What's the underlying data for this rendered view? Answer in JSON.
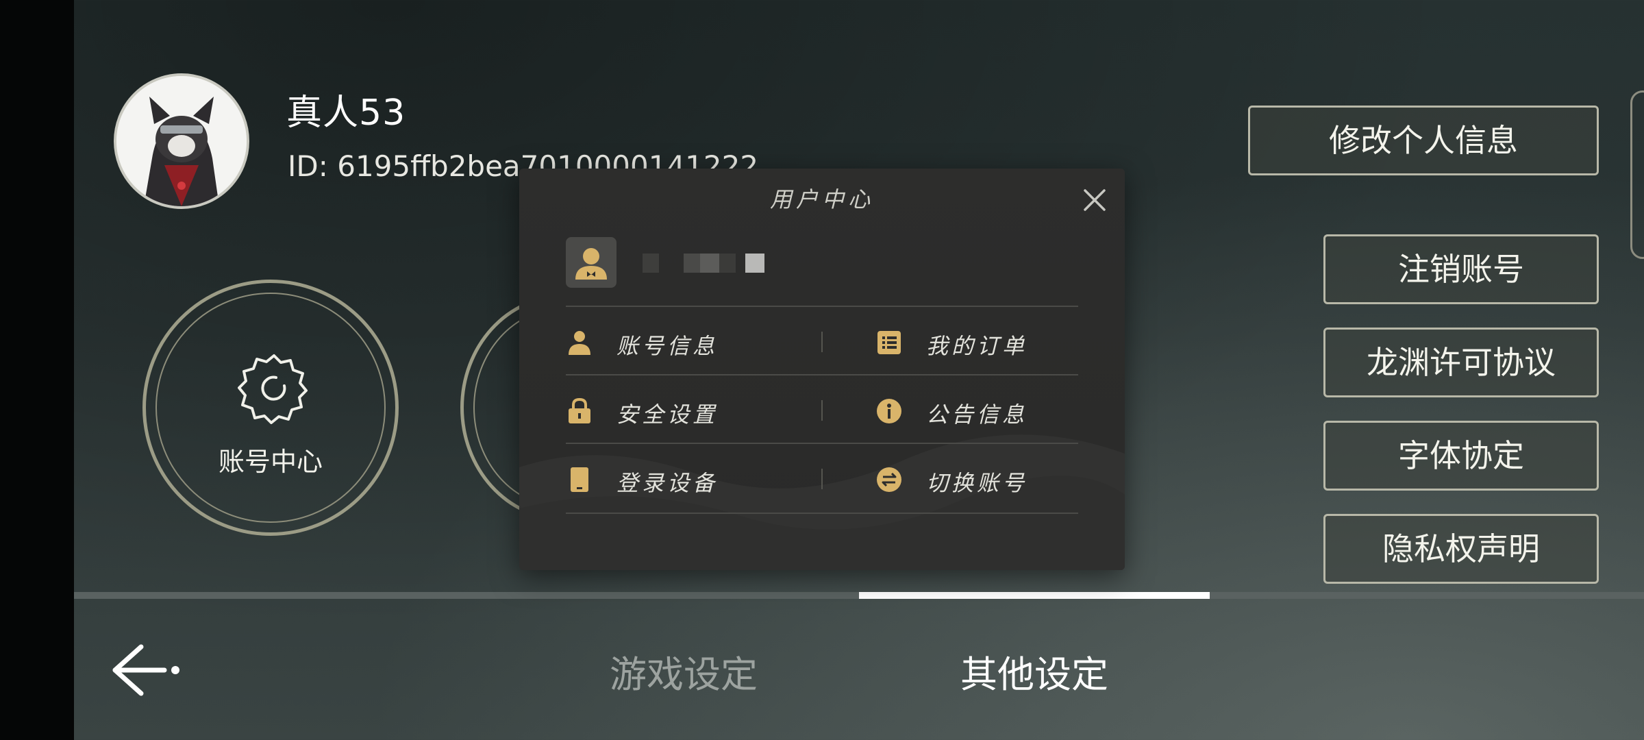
{
  "profile": {
    "username": "真人53",
    "user_id": "ID: 6195ffb2bea7010000141222"
  },
  "circles": {
    "account_center_label": "账号中心"
  },
  "right_buttons": {
    "edit_profile": "修改个人信息",
    "cancel_account": "注销账号",
    "longyuan_license": "龙渊许可协议",
    "font_agreement": "字体协定",
    "privacy_statement": "隐私权声明"
  },
  "tabs": {
    "game_settings": "游戏设定",
    "other_settings": "其他设定",
    "active": "其他设定"
  },
  "modal": {
    "title": "用户中心",
    "menu": [
      {
        "label": "账号信息",
        "icon": "person-icon"
      },
      {
        "label": "我的订单",
        "icon": "list-icon"
      },
      {
        "label": "安全设置",
        "icon": "lock-icon"
      },
      {
        "label": "公告信息",
        "icon": "info-icon"
      },
      {
        "label": "登录设备",
        "icon": "device-icon"
      },
      {
        "label": "切换账号",
        "icon": "switch-icon"
      }
    ]
  },
  "colors": {
    "accent_gold": "#d9b46a",
    "button_border": "#b8b8a8",
    "active_tab": "#ffffff",
    "inactive_tab": "#9da3a0"
  }
}
